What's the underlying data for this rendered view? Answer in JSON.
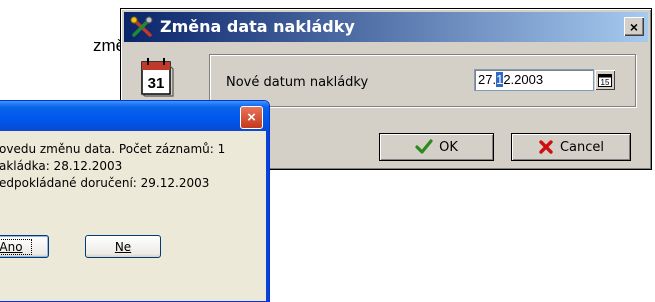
{
  "background": {
    "text": "změnit"
  },
  "date_dialog": {
    "title": "Změna data nakládky",
    "close_glyph": "×",
    "date_label": "Nové datum nakládky",
    "date_value_before": "27.",
    "date_value_selected": "1",
    "date_value_after": "2.2003",
    "calendar_icon_day": "31",
    "picker_icon_day": "15",
    "ok_label": "OK",
    "cancel_label": "Cancel"
  },
  "message_box": {
    "close_glyph": "×",
    "lines": [
      "ovedu změnu data. Počet záznamů: 1",
      "akládka: 28.12.2003",
      "edpokládané doručení: 29.12.2003"
    ],
    "yes_label": "Ano",
    "no_label": "Ne"
  },
  "colors": {
    "classic_title_start": "#0a246a",
    "classic_title_end": "#a6caf0",
    "xp_title": "#0058ee",
    "ok_check": "#2a8a1c",
    "cancel_x": "#cc1010"
  }
}
